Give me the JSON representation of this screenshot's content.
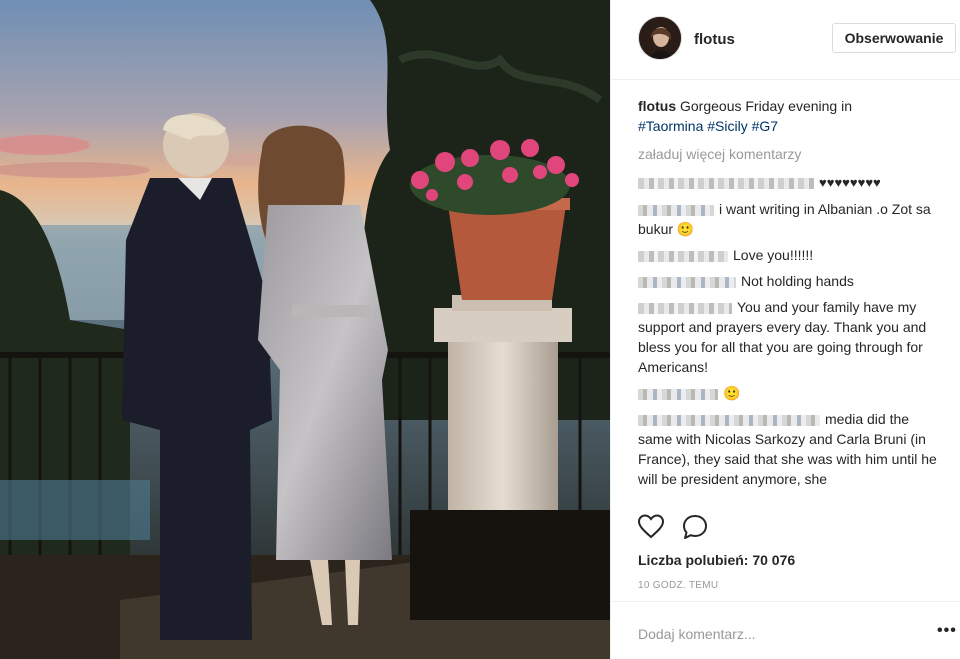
{
  "post": {
    "username": "flotus",
    "follow_label": "Obserwowanie",
    "caption_user": "flotus",
    "caption_text": " Gorgeous Friday evening in ",
    "tags": [
      "#Taormina",
      "#Sicily",
      "#G7"
    ],
    "load_more": "załaduj więcej komentarzy",
    "likes_label": "Liczba polubień: 70 076",
    "time_label": "10 GODZ. TEMU",
    "add_comment_placeholder": "Dodaj komentarz...",
    "more_label": "•••"
  },
  "comments": [
    {
      "text": "♥♥♥♥♥♥♥♥"
    },
    {
      "text": "i want writing in Albanian .o Zot sa bukur 🙂"
    },
    {
      "text": "Love you!!!!!!"
    },
    {
      "text": "Not holding hands"
    },
    {
      "text": "You and your family have my support and prayers every day. Thank you and bless you for all that you are going through for Americans!"
    },
    {
      "text": "🙂"
    },
    {
      "text": "media did the same with Nicolas Sarkozy and Carla Bruni (in France), they said that she was with him until he will be president anymore, she"
    }
  ],
  "icons": {
    "like": "heart-outline-icon",
    "comment": "speech-bubble-icon"
  },
  "colors": {
    "link": "#003569",
    "muted": "#999999",
    "text": "#262626"
  }
}
